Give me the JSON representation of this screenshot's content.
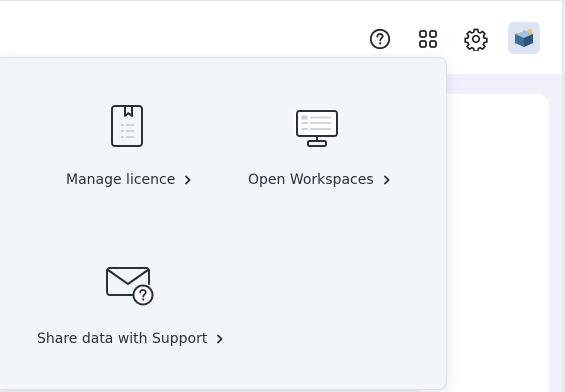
{
  "toolbar": {
    "help_icon": "help-circle-icon",
    "apps_icon": "grid-apps-icon",
    "settings_icon": "gear-icon",
    "avatar_icon": "product-box-avatar"
  },
  "menu": {
    "items": [
      {
        "label": "Manage licence",
        "icon": "licence-book-icon"
      },
      {
        "label": "Open Workspaces",
        "icon": "monitor-icon"
      },
      {
        "label": "Share data with Support",
        "icon": "mail-question-icon"
      }
    ]
  },
  "colors": {
    "menu_background": "#f2f5f9",
    "content_background": "#f1f1fb",
    "icon_stroke": "#2a2f3a",
    "accent_lines": "#c8d1dd"
  }
}
